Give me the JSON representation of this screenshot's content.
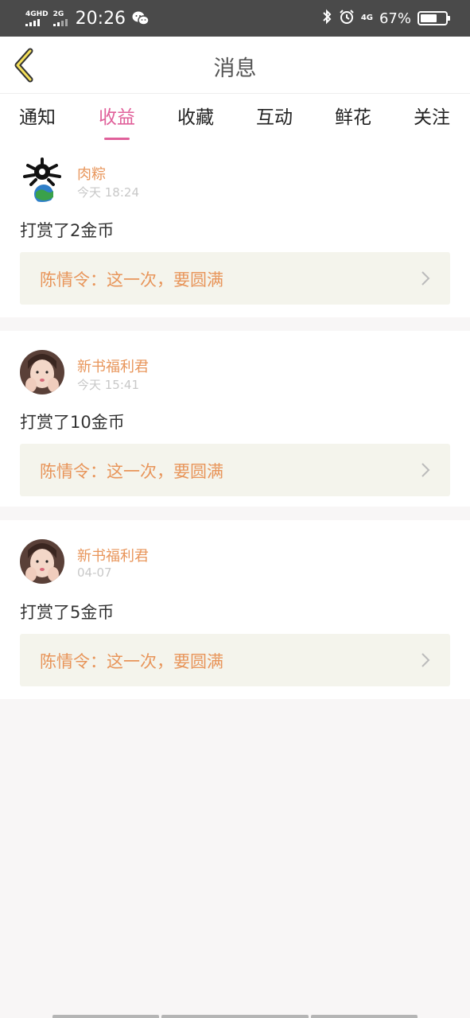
{
  "status_bar": {
    "sim1_label": "4GHD",
    "sim2_label": "2G",
    "time": "20:26",
    "net_label": "4G",
    "battery_text": "67%",
    "battery_level": 0.67
  },
  "header": {
    "title": "消息"
  },
  "tabs": [
    {
      "label": "通知",
      "active": false
    },
    {
      "label": "收益",
      "active": true
    },
    {
      "label": "收藏",
      "active": false
    },
    {
      "label": "互动",
      "active": false
    },
    {
      "label": "鲜花",
      "active": false
    },
    {
      "label": "关注",
      "active": false
    }
  ],
  "messages": [
    {
      "user": "肉粽",
      "time": "今天 18:24",
      "action": "打赏了2金币",
      "book": "陈情令：这一次，要圆满",
      "avatar": "planet-avatar"
    },
    {
      "user": "新书福利君",
      "time": "今天 15:41",
      "action": "打赏了10金币",
      "book": "陈情令：这一次，要圆满",
      "avatar": "girl-avatar"
    },
    {
      "user": "新书福利君",
      "time": "04-07",
      "action": "打赏了5金币",
      "book": "陈情令：这一次，要圆满",
      "avatar": "girl-avatar"
    }
  ],
  "colors": {
    "accent": "#e0609a",
    "username": "#e8955a",
    "book_bg": "#f4f4ec",
    "status_bg": "#4a4a4a"
  }
}
